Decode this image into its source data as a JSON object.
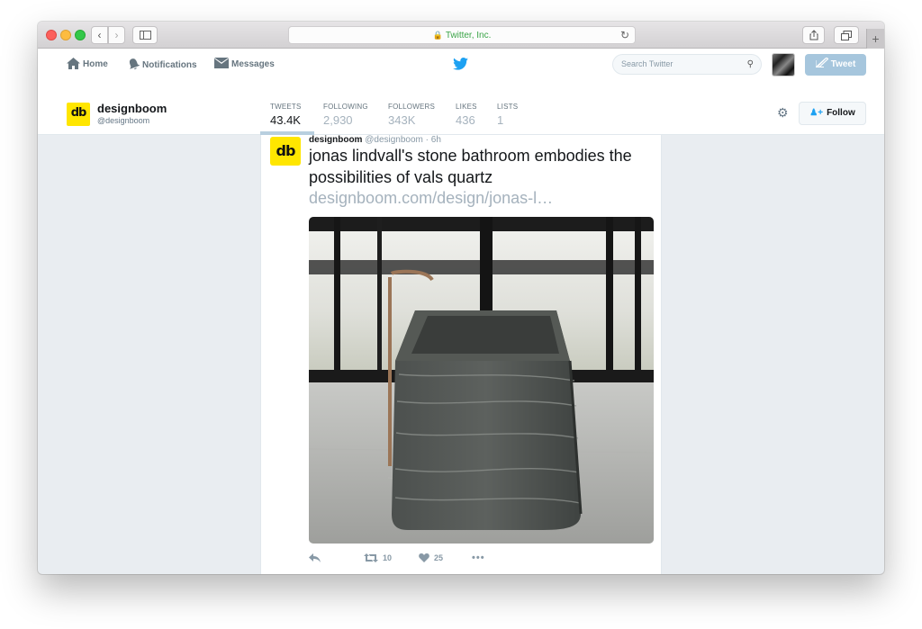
{
  "browser": {
    "address": "Twitter, Inc.",
    "back_glyph": "‹",
    "forward_glyph": "›",
    "new_tab_glyph": "+"
  },
  "nav": {
    "home": "Home",
    "notifications": "Notifications",
    "messages": "Messages",
    "search_placeholder": "Search Twitter",
    "tweet_button": "Tweet"
  },
  "profile": {
    "logo_text": "db",
    "name": "designboom",
    "handle": "@designboom",
    "stats": [
      {
        "label": "TWEETS",
        "value": "43.4K"
      },
      {
        "label": "FOLLOWING",
        "value": "2,930"
      },
      {
        "label": "FOLLOWERS",
        "value": "343K"
      },
      {
        "label": "LIKES",
        "value": "436"
      },
      {
        "label": "LISTS",
        "value": "1"
      }
    ],
    "follow_button": "Follow"
  },
  "tweet": {
    "author": "designboom",
    "handle_time": "@designboom · 6h",
    "text": "jonas lindvall's stone bathroom embodies the possibilities of vals quartz",
    "link": "designboom.com/design/jonas-l…",
    "retweets": "10",
    "likes": "25",
    "more_glyph": "•••"
  },
  "colors": {
    "twitter_blue": "#1da1f2",
    "logo_yellow": "#ffe600",
    "tweet_button_disabled": "#a6c6dd",
    "secure_green": "#3aa447"
  }
}
